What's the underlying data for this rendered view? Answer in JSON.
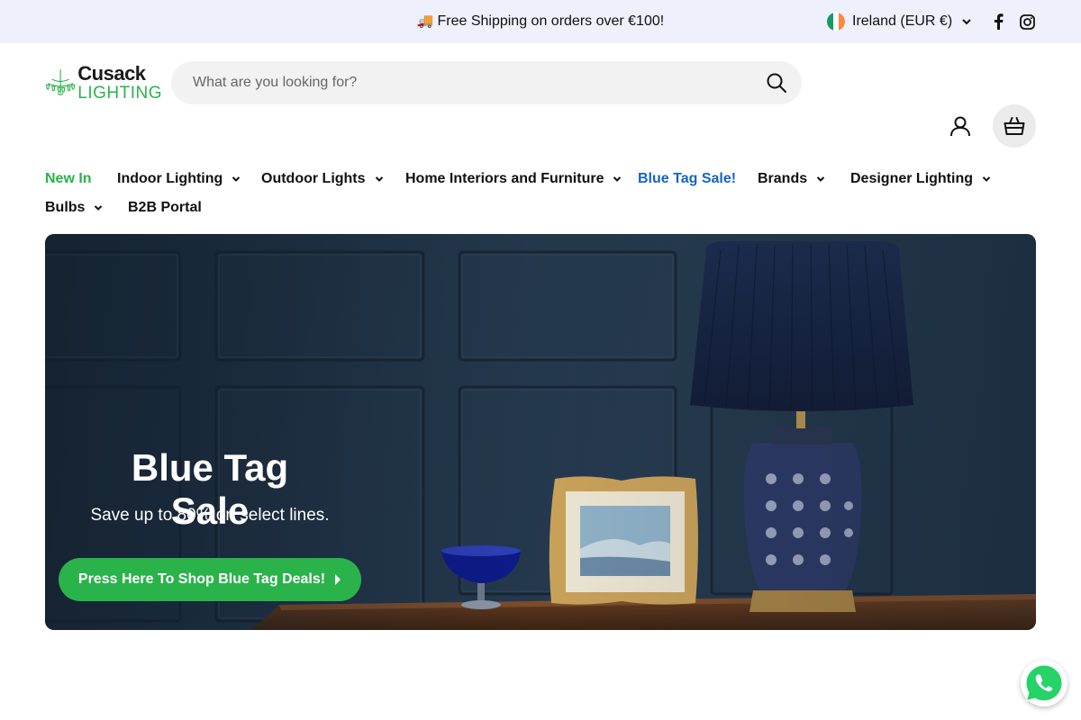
{
  "announcement": {
    "icon": "delivery-truck-icon",
    "emoji": "🚚",
    "text": "Free Shipping on orders over €100!"
  },
  "country_selector": {
    "label": "Ireland (EUR €)",
    "flag_colors": [
      "#169b62",
      "#ffffff",
      "#ff883e"
    ]
  },
  "social": [
    "facebook-icon",
    "instagram-icon"
  ],
  "logo": {
    "line1": "Cusack",
    "line2": "LIGHTING"
  },
  "search": {
    "placeholder": "What are you looking for?"
  },
  "nav": {
    "items": [
      {
        "label": "New In",
        "style": "green",
        "dropdown": false
      },
      {
        "label": "Indoor Lighting",
        "dropdown": true
      },
      {
        "label": "Outdoor Lights",
        "dropdown": true
      },
      {
        "label": "Home Interiors and Furniture",
        "dropdown": true
      },
      {
        "label": "Blue Tag Sale!",
        "style": "blue",
        "dropdown": false
      },
      {
        "label": "Brands",
        "dropdown": true
      },
      {
        "label": "Designer Lighting",
        "dropdown": true
      },
      {
        "label": "Bulbs",
        "dropdown": true
      },
      {
        "label": "B2B Portal",
        "dropdown": false
      }
    ]
  },
  "hero": {
    "title": "Blue Tag Sale",
    "subtitle": "Save up to 80% on select lines.",
    "button": "Press Here To Shop Blue Tag Deals!"
  },
  "colors": {
    "brand_green": "#2ab34a",
    "sale_blue": "#1565c0",
    "topbar_bg": "#eef0fb"
  }
}
